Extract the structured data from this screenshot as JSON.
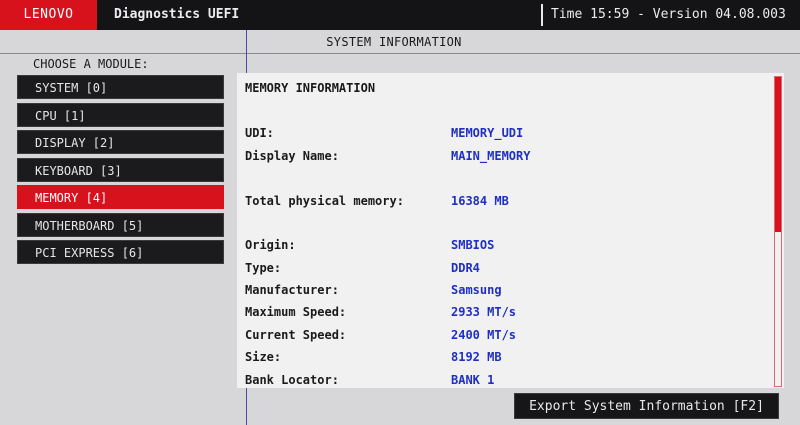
{
  "header": {
    "brand": "LENOVO",
    "title": "Diagnostics UEFI",
    "status": "Time 15:59 - Version 04.08.003"
  },
  "window_title": "SYSTEM INFORMATION",
  "sidebar": {
    "label": "CHOOSE A MODULE:",
    "items": [
      {
        "label": "SYSTEM [0]",
        "active": false
      },
      {
        "label": "CPU [1]",
        "active": false
      },
      {
        "label": "DISPLAY [2]",
        "active": false
      },
      {
        "label": "KEYBOARD [3]",
        "active": false
      },
      {
        "label": "MEMORY [4]",
        "active": true
      },
      {
        "label": "MOTHERBOARD [5]",
        "active": false
      },
      {
        "label": "PCI EXPRESS [6]",
        "active": false
      }
    ]
  },
  "panel": {
    "heading": "MEMORY INFORMATION",
    "rows": [
      {
        "key": "UDI:",
        "value": "MEMORY_UDI"
      },
      {
        "key": "Display Name:",
        "value": "MAIN_MEMORY"
      },
      {
        "key": "Total physical memory:",
        "value": "16384 MB"
      },
      {
        "key": "Origin:",
        "value": "SMBIOS"
      },
      {
        "key": "Type:",
        "value": "DDR4"
      },
      {
        "key": "Manufacturer:",
        "value": "Samsung"
      },
      {
        "key": "Maximum Speed:",
        "value": "2933 MT/s"
      },
      {
        "key": "Current Speed:",
        "value": "2400 MT/s"
      },
      {
        "key": "Size:",
        "value": "8192 MB"
      },
      {
        "key": "Bank Locator:",
        "value": "BANK 1"
      }
    ]
  },
  "scroll": {
    "position": 0.0,
    "visible_fraction": 0.5
  },
  "actions": {
    "export_label": "Export System Information [F2]"
  },
  "colors": {
    "accent": "#d8121c",
    "value_text": "#1f2fc4",
    "bar": "#141416"
  }
}
